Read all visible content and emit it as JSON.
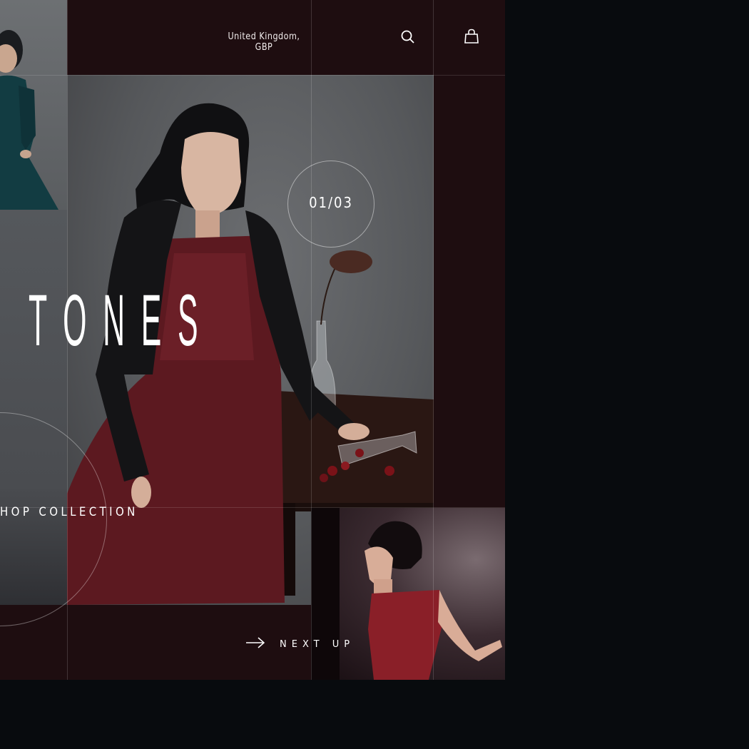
{
  "header": {
    "locale": "United Kingdom, GBP",
    "search_icon": "search-icon",
    "bag_icon": "shopping-bag-icon"
  },
  "hero": {
    "headline": "TONES",
    "slide_counter": "01/03"
  },
  "actions": {
    "shop_label": "HOP COLLECTION",
    "next_label": "NEXT UP",
    "next_icon": "arrow-right-icon"
  },
  "colors": {
    "frame": "#1e0d10",
    "backdrop": "#080b0e",
    "dress_accent": "#6b1a22",
    "text": "#ffffff"
  }
}
